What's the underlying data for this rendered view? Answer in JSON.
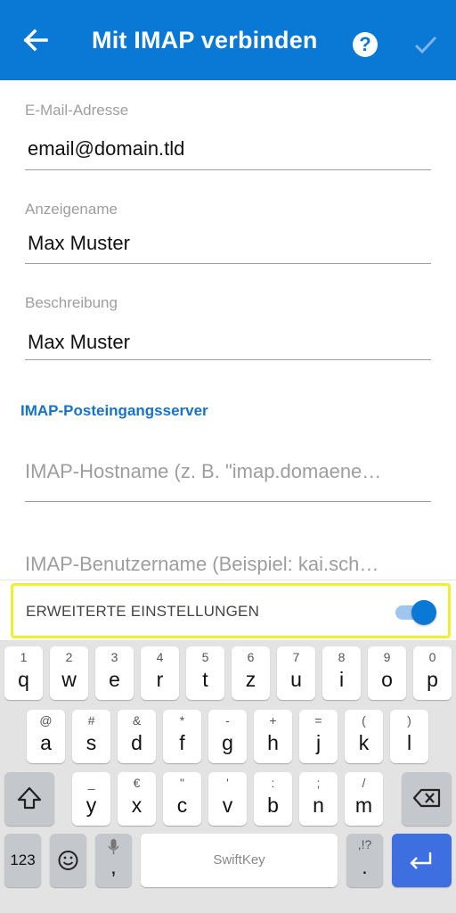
{
  "header": {
    "title": "Mit IMAP verbinden",
    "help_glyph": "?"
  },
  "form": {
    "email": {
      "label": "E-Mail-Adresse",
      "value": "email@domain.tld"
    },
    "display_name": {
      "label": "Anzeigename",
      "value": "Max Muster"
    },
    "description": {
      "label": "Beschreibung",
      "value": "Max Muster"
    },
    "section_title": "IMAP-Posteingangsserver",
    "hostname_placeholder": "IMAP-Hostname (z. B. \"imap.domaene…",
    "username_placeholder": "IMAP-Benutzername (Beispiel: kai.sch…"
  },
  "advanced": {
    "label": "ERWEITERTE EINSTELLUNGEN",
    "enabled": true
  },
  "keyboard": {
    "row1": [
      {
        "hint": "1",
        "key": "q"
      },
      {
        "hint": "2",
        "key": "w"
      },
      {
        "hint": "3",
        "key": "e"
      },
      {
        "hint": "4",
        "key": "r"
      },
      {
        "hint": "5",
        "key": "t"
      },
      {
        "hint": "6",
        "key": "z"
      },
      {
        "hint": "7",
        "key": "u"
      },
      {
        "hint": "8",
        "key": "i"
      },
      {
        "hint": "9",
        "key": "o"
      },
      {
        "hint": "0",
        "key": "p"
      }
    ],
    "row2": [
      {
        "hint": "@",
        "key": "a"
      },
      {
        "hint": "#",
        "key": "s"
      },
      {
        "hint": "&",
        "key": "d"
      },
      {
        "hint": "*",
        "key": "f"
      },
      {
        "hint": "-",
        "key": "g"
      },
      {
        "hint": "+",
        "key": "h"
      },
      {
        "hint": "=",
        "key": "j"
      },
      {
        "hint": "(",
        "key": "k"
      },
      {
        "hint": ")",
        "key": "l"
      }
    ],
    "row3": [
      {
        "hint": "_",
        "key": "y"
      },
      {
        "hint": "€",
        "key": "x"
      },
      {
        "hint": "\"",
        "key": "c"
      },
      {
        "hint": "'",
        "key": "v"
      },
      {
        "hint": ":",
        "key": "b"
      },
      {
        "hint": ";",
        "key": "n"
      },
      {
        "hint": "/",
        "key": "m"
      }
    ],
    "numbers_label": "123",
    "comma_key": ",",
    "space_brand": "SwiftKey",
    "period_hint": ",!?",
    "period_key": "."
  },
  "colors": {
    "accent": "#0a78d5",
    "highlight": "#f0f02a"
  }
}
